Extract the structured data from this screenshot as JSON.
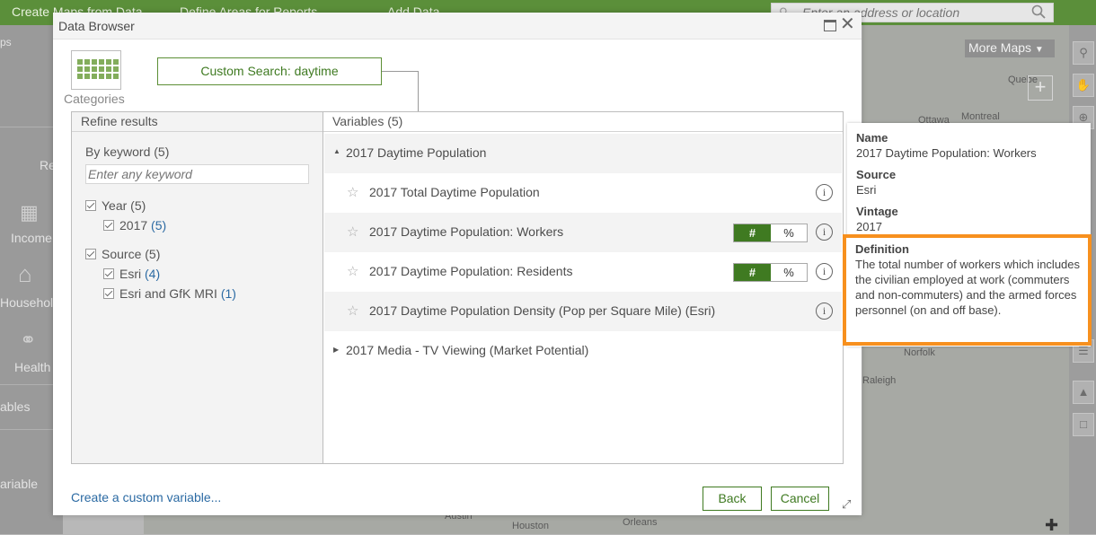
{
  "app": {
    "tabs": [
      "Create Maps from Data",
      "Define Areas for Reports",
      "Add Data"
    ],
    "search_placeholder": "Enter an address or location",
    "left_panel": {
      "top_label": "ps",
      "re_label": "Re",
      "items": [
        "Income",
        "Househol",
        "Health"
      ],
      "variables_label": "ables",
      "variable_label": "ariable"
    },
    "more_maps": "More Maps",
    "zoom_in": "+",
    "map_labels": [
      "Quebe",
      "Ottawa",
      "Montreal",
      "Norfolk",
      "Raleigh",
      "Austin",
      "Houston",
      "Orleans"
    ]
  },
  "dialog": {
    "title": "Data Browser",
    "categories_label": "Categories",
    "breadcrumb": "Custom Search: daytime",
    "refine": {
      "header": "Refine results",
      "keyword_label": "By keyword (5)",
      "keyword_placeholder": "Enter any keyword",
      "year": {
        "label": "Year (5)",
        "options": [
          {
            "label": "2017",
            "count": "(5)"
          }
        ]
      },
      "source": {
        "label": "Source (5)",
        "options": [
          {
            "label": "Esri",
            "count": "(4)"
          },
          {
            "label": "Esri and GfK MRI",
            "count": "(1)"
          }
        ]
      }
    },
    "variables": {
      "header": "Variables (5)",
      "group1": "2017 Daytime Population",
      "items": [
        "2017 Total Daytime Population",
        "2017 Daytime Population: Workers",
        "2017 Daytime Population: Residents",
        "2017 Daytime Population Density (Pop per Square Mile) (Esri)"
      ],
      "group2": "2017 Media - TV Viewing (Market Potential)",
      "toggle_hash": "#",
      "toggle_pct": "%",
      "info": "i"
    },
    "custom_link": "Create a custom variable...",
    "back": "Back",
    "cancel": "Cancel"
  },
  "tooltip": {
    "name_label": "Name",
    "name": "2017 Daytime Population: Workers",
    "source_label": "Source",
    "source": "Esri",
    "vintage_label": "Vintage",
    "vintage": "2017",
    "definition_label": "Definition",
    "definition": "The total number of workers which includes the civilian employed at work (commuters and non-commuters) and the armed forces personnel (on and off base).",
    "highlight_color": "#f7901e"
  },
  "colors": {
    "accent_green": "#3f7a21",
    "link_blue": "#2b6aa3",
    "highlight_orange": "#f7901e"
  }
}
